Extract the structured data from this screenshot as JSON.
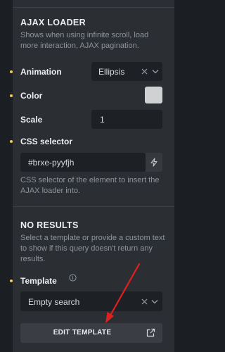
{
  "ajax_loader": {
    "title": "AJAX LOADER",
    "description": "Shows when using infinite scroll, load more interaction, AJAX pagination.",
    "animation": {
      "label": "Animation",
      "value": "Ellipsis"
    },
    "color": {
      "label": "Color",
      "swatch": "#cfd1d3"
    },
    "scale": {
      "label": "Scale",
      "value": "1"
    },
    "css_selector": {
      "label": "CSS selector",
      "value": "#brxe-pyyfjh",
      "help": "CSS selector of the element to insert the AJAX loader into."
    }
  },
  "no_results": {
    "title": "NO RESULTS",
    "description": "Select a template or provide a custom text to show if this query doesn't return any results.",
    "template": {
      "label": "Template",
      "value": "Empty search"
    },
    "edit_button": "EDIT TEMPLATE"
  },
  "colors": {
    "indicator": "#f2c94c",
    "annotation_arrow": "#e0201f"
  }
}
